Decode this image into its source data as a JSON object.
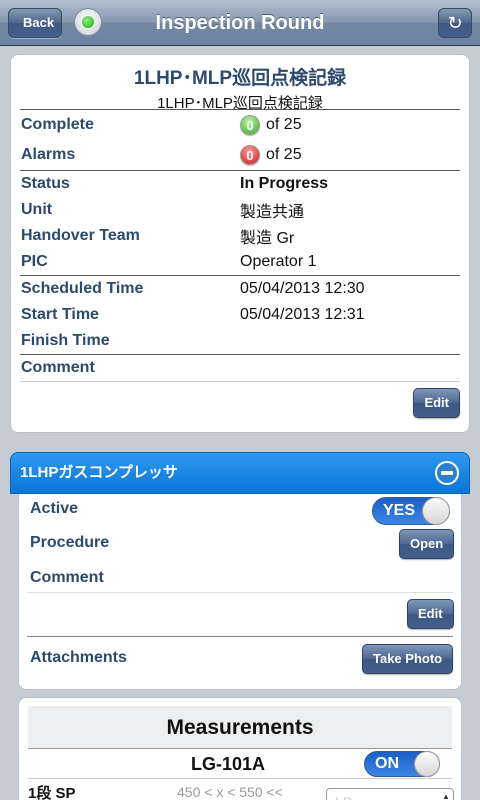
{
  "nav": {
    "back_label": "Back",
    "title": "Inspection Round"
  },
  "round": {
    "title": "1LHP･MLP巡回点検記録",
    "subtitle": "1LHP･MLP巡回点検記録",
    "complete_label": "Complete",
    "complete_count": "0",
    "complete_total": "of 25",
    "alarms_label": "Alarms",
    "alarms_count": "0",
    "alarms_total": "of 25",
    "status_label": "Status",
    "status_value": "In Progress",
    "unit_label": "Unit",
    "unit_value": "製造共通",
    "team_label": "Handover Team",
    "team_value": "製造 Gr",
    "pic_label": "PIC",
    "pic_value": "Operator 1",
    "scheduled_label": "Scheduled Time",
    "scheduled_value": "05/04/2013 12:30",
    "start_label": "Start Time",
    "start_value": "05/04/2013 12:31",
    "finish_label": "Finish Time",
    "finish_value": "",
    "comment_label": "Comment",
    "comment_value": "",
    "edit_label": "Edit"
  },
  "equipment": {
    "title": "1LHPガスコンプレッサ",
    "active_label": "Active",
    "active_toggle": "YES",
    "procedure_label": "Procedure",
    "open_label": "Open",
    "comment_label": "Comment",
    "edit_label": "Edit",
    "attachments_label": "Attachments",
    "take_photo_label": "Take Photo"
  },
  "measurements": {
    "title": "Measurements",
    "tag": "LG-101A",
    "toggle": "ON",
    "row_label": "1段 SP",
    "range": "450 < x < 550 <<",
    "placeholder": "LP"
  },
  "colors": {
    "accent_blue": "#0b75d9",
    "label_blue": "#2c4a6e",
    "status_green": "#1ea31b",
    "alarm_red": "#c91a1a"
  }
}
